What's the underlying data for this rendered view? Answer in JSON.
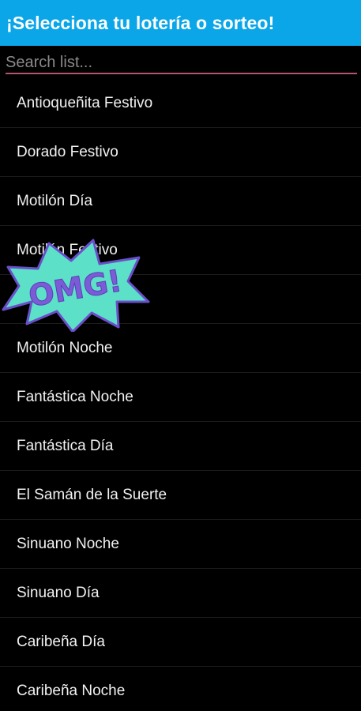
{
  "appbar": {
    "title": "¡Selecciona tu lotería o sorteo!",
    "background_color": "#0aa6e8"
  },
  "search": {
    "placeholder": "Search list...",
    "value": "",
    "underline_color": "#b4556b"
  },
  "list": {
    "items": [
      {
        "label": "Antioqueñita Festivo"
      },
      {
        "label": "Dorado Festivo"
      },
      {
        "label": "Motilón Día"
      },
      {
        "label": "Motilón Festivo"
      },
      {
        "label": ""
      },
      {
        "label": "Motilón Noche"
      },
      {
        "label": "Fantástica Noche"
      },
      {
        "label": "Fantástica Día"
      },
      {
        "label": "El Samán de la Suerte"
      },
      {
        "label": "Sinuano Noche"
      },
      {
        "label": "Sinuano Día"
      },
      {
        "label": "Caribeña Día"
      },
      {
        "label": "Caribeña Noche"
      }
    ]
  },
  "overlay": {
    "badge_text": "OMG!",
    "badge_fill_color": "#5ce0c8",
    "badge_text_color": "#7b5cd6",
    "badge_outline_color": "#6a4fc9",
    "icon": "burst-badge-icon"
  }
}
